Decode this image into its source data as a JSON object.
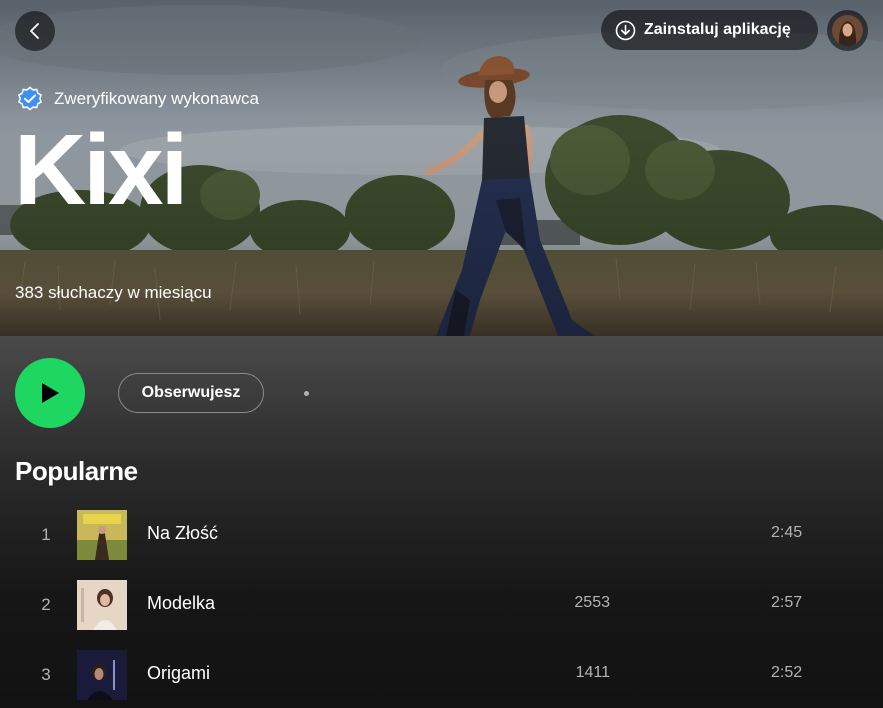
{
  "header": {
    "install_label": "Zainstaluj aplikację",
    "back_icon": "chevron-left-icon",
    "download_icon": "download-circle-icon"
  },
  "artist": {
    "verified_label": "Zweryfikowany wykonawca",
    "name": "Kixi",
    "monthly_listeners": "383 słuchaczy w miesiącu"
  },
  "actions": {
    "follow_label": "Obserwujesz",
    "play_icon": "play-icon",
    "more_icon": "more-horizontal-icon"
  },
  "popular": {
    "title": "Popularne",
    "tracks": [
      {
        "num": "1",
        "title": "Na Złość",
        "plays": "",
        "duration": "2:45"
      },
      {
        "num": "2",
        "title": "Modelka",
        "plays": "2553",
        "duration": "2:57"
      },
      {
        "num": "3",
        "title": "Origami",
        "plays": "1411",
        "duration": "2:52"
      }
    ]
  },
  "colors": {
    "accent_green": "#1ed760",
    "verified_blue": "#3d91f4",
    "background": "#121212",
    "secondary_text": "#b3b3b3"
  }
}
